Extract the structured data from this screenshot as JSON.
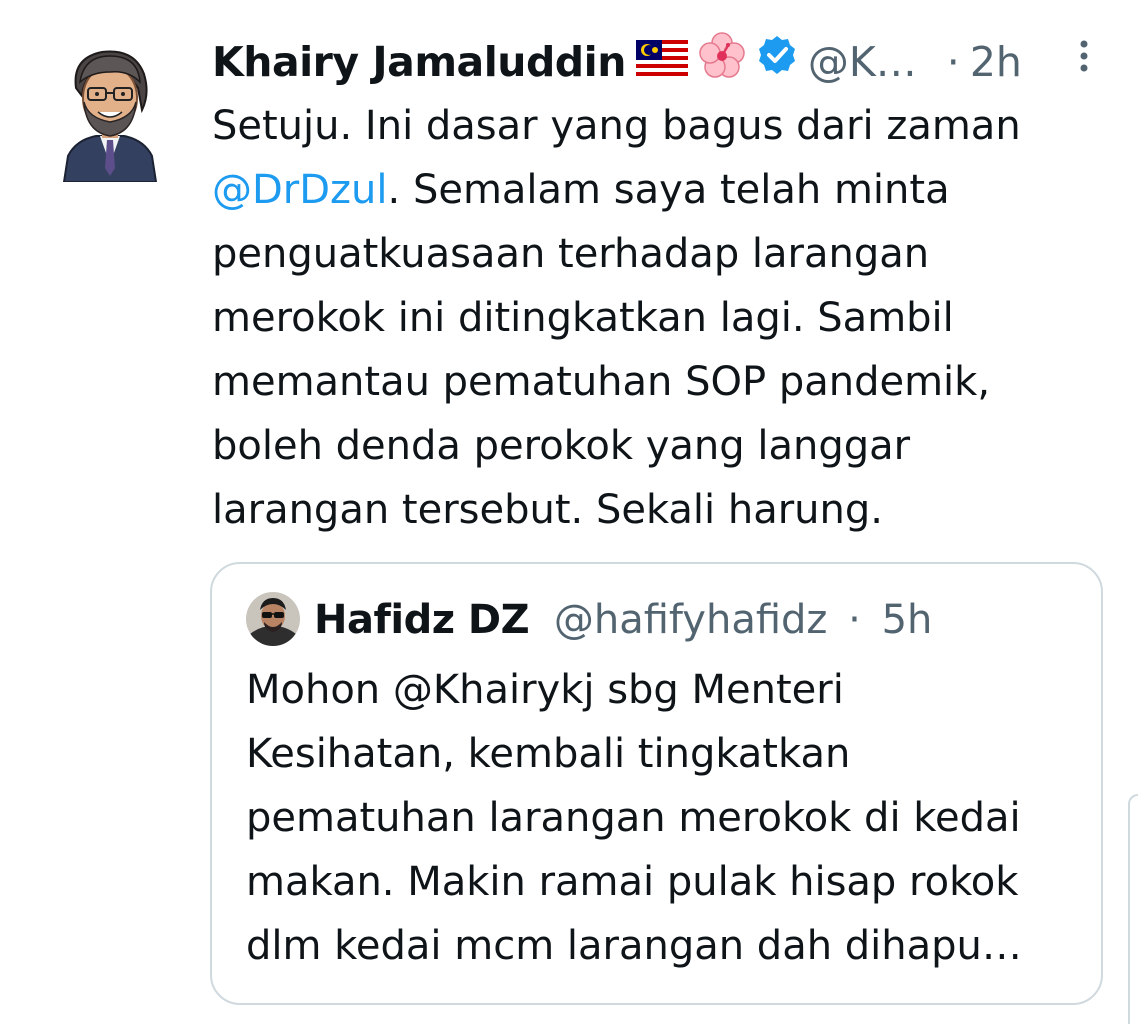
{
  "tweet": {
    "author_name": "Khairy Jamaluddin",
    "handle": "@K…",
    "dot": "·",
    "time": "2h",
    "emojis": [
      "malaysia-flag-icon",
      "hibiscus-icon",
      "verified-badge-icon"
    ],
    "lines": [
      "Setuju. Ini dasar yang bagus dari zaman",
      "@DrDzul",
      ". Semalam saya telah minta",
      "penguatkuasaan terhadap larangan",
      "merokok ini ditingkatkan lagi. Sambil",
      "memantau pematuhan SOP pandemik,",
      "boleh denda perokok yang langgar",
      "larangan tersebut. Sekali harung."
    ]
  },
  "quote": {
    "author_name": "Hafidz DZ",
    "handle": "@hafifyhafidz",
    "dot": "·",
    "time": "5h",
    "lines": [
      "Mohon @Khairykj sbg Menteri",
      "Kesihatan, kembali tingkatkan",
      "pematuhan larangan merokok di kedai",
      "makan. Makin ramai pulak hisap rokok",
      "dlm kedai mcm larangan dah dihapu…"
    ]
  },
  "colors": {
    "text": "#0f1419",
    "secondary": "#536471",
    "link": "#1d9bf0",
    "border": "#cfd9de",
    "verified": "#1d9bf0"
  }
}
